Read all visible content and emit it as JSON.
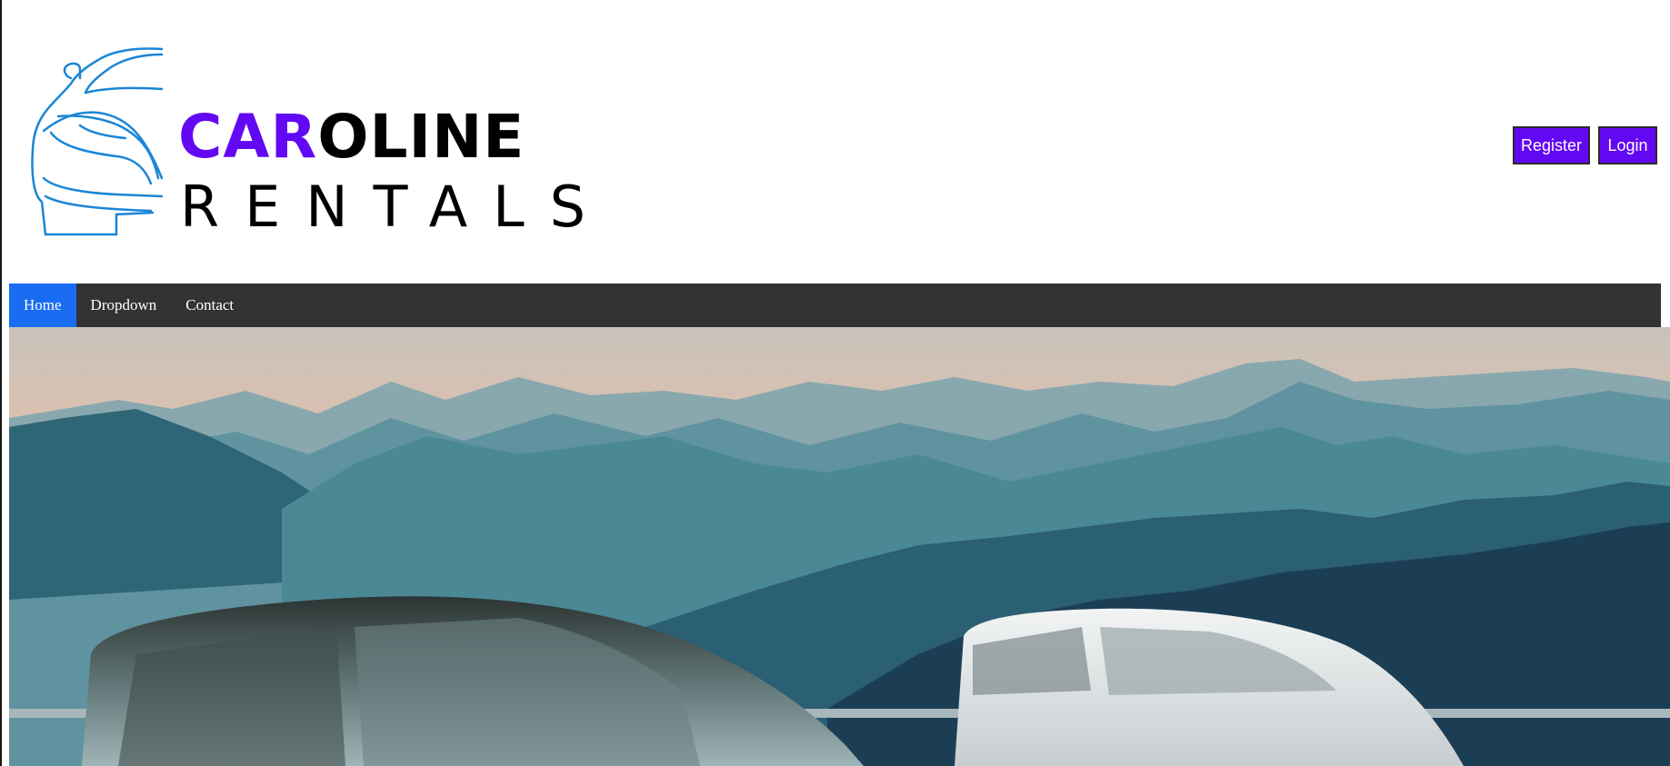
{
  "brand": {
    "line1_accent": "CAR",
    "line1_rest": "OLINE",
    "line2": "RENTALS",
    "logo_icon": "car-outline-logo",
    "accent_color": "#6308f3",
    "logo_stroke_color": "#1a86d6"
  },
  "auth": {
    "register_label": "Register",
    "login_label": "Login",
    "button_color": "#6308f3"
  },
  "nav": {
    "items": [
      {
        "label": "Home",
        "active": true
      },
      {
        "label": "Dropdown",
        "active": false
      },
      {
        "label": "Contact",
        "active": false
      }
    ],
    "bar_color": "#333333",
    "active_color": "#1a6cf2"
  },
  "hero": {
    "image_description_icon": "mountain-vans-hero-image"
  }
}
